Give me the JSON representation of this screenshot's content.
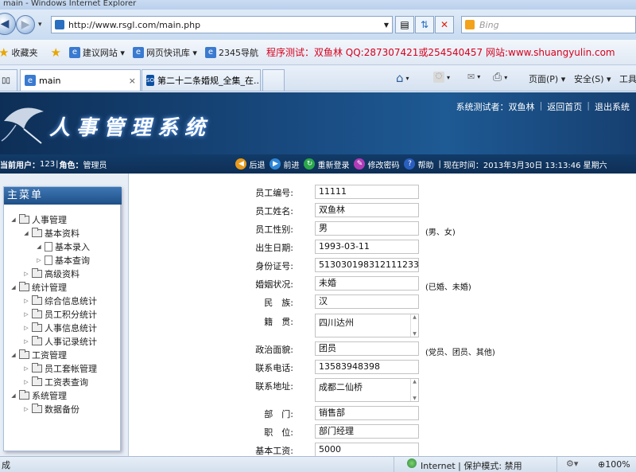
{
  "window": {
    "title": "main - Windows Internet Explorer"
  },
  "browser": {
    "url": "http://www.rsgl.com/main.php",
    "search_placeholder": "Bing",
    "favorites_label": "收藏夹",
    "fav_items": [
      "建议网站 ▾",
      "网页快讯库 ▾",
      "2345导航"
    ],
    "promo": "程序测试：双鱼林 QQ:287307421或254540457 网站:www.shuangyulin.com",
    "tabs": [
      {
        "label": "main"
      },
      {
        "label": "第二十二条婚规_全集_在..."
      }
    ],
    "commands": {
      "page": "页面(P) ▾",
      "safety": "安全(S) ▾",
      "tools": "工具"
    }
  },
  "app": {
    "title": "人事管理系统",
    "header_links": [
      "系统测试者：双鱼林",
      "返回首页",
      "退出系统"
    ],
    "user_label": "当前用户：",
    "user_value": "123",
    "role_label": "角色：",
    "role_value": "管理员",
    "nav": [
      "后退",
      "前进",
      "重新登录",
      "修改密码",
      "帮助"
    ],
    "time_text": "现在时间：2013年3月30日 13:13:46 星期六"
  },
  "sidebar": {
    "title": "主菜单",
    "tree": [
      {
        "label": "人事管理",
        "level": 0,
        "open": true,
        "kind": "folder"
      },
      {
        "label": "基本资料",
        "level": 1,
        "open": true,
        "kind": "folder"
      },
      {
        "label": "基本录入",
        "level": 2,
        "open": true,
        "kind": "doc"
      },
      {
        "label": "基本查询",
        "level": 2,
        "open": false,
        "kind": "doc"
      },
      {
        "label": "高级资料",
        "level": 1,
        "open": false,
        "kind": "folder"
      },
      {
        "label": "统计管理",
        "level": 0,
        "open": true,
        "kind": "folder"
      },
      {
        "label": "综合信息统计",
        "level": 1,
        "open": false,
        "kind": "folder"
      },
      {
        "label": "员工积分统计",
        "level": 1,
        "open": false,
        "kind": "folder"
      },
      {
        "label": "人事信息统计",
        "level": 1,
        "open": false,
        "kind": "folder"
      },
      {
        "label": "人事记录统计",
        "level": 1,
        "open": false,
        "kind": "folder"
      },
      {
        "label": "工资管理",
        "level": 0,
        "open": true,
        "kind": "folder"
      },
      {
        "label": "员工套帐管理",
        "level": 1,
        "open": false,
        "kind": "folder"
      },
      {
        "label": "工资表查询",
        "level": 1,
        "open": false,
        "kind": "folder"
      },
      {
        "label": "系统管理",
        "level": 0,
        "open": true,
        "kind": "folder"
      },
      {
        "label": "数据备份",
        "level": 1,
        "open": false,
        "kind": "folder"
      }
    ]
  },
  "form": {
    "fields": [
      {
        "label": "员工编号:",
        "value": "11111",
        "hint": ""
      },
      {
        "label": "员工姓名:",
        "value": "双鱼林",
        "hint": ""
      },
      {
        "label": "员工性别:",
        "value": "男",
        "hint": "(男、女)"
      },
      {
        "label": "出生日期:",
        "value": "1993-03-11",
        "hint": ""
      },
      {
        "label": "身份证号:",
        "value": "513030198312111233",
        "hint": ""
      },
      {
        "label": "婚姻状况:",
        "value": "未婚",
        "hint": "(已婚、未婚)"
      },
      {
        "label": "民　族:",
        "value": "汉",
        "hint": ""
      },
      {
        "label": "籍　贯:",
        "value": "四川达州",
        "hint": "",
        "multiline": true
      },
      {
        "label": "政治面貌:",
        "value": "团员",
        "hint": "(党员、团员、其他)"
      },
      {
        "label": "联系电话:",
        "value": "13583948398",
        "hint": ""
      },
      {
        "label": "联系地址:",
        "value": "成都二仙桥",
        "hint": "",
        "multiline": true
      },
      {
        "label": "部　门:",
        "value": "销售部",
        "hint": ""
      },
      {
        "label": "职　位:",
        "value": "部门经理",
        "hint": ""
      },
      {
        "label": "基本工资:",
        "value": "5000",
        "hint": ""
      }
    ]
  },
  "status": {
    "left": "成",
    "zone": "Internet | 保护模式: 禁用",
    "zoom": "100%"
  }
}
